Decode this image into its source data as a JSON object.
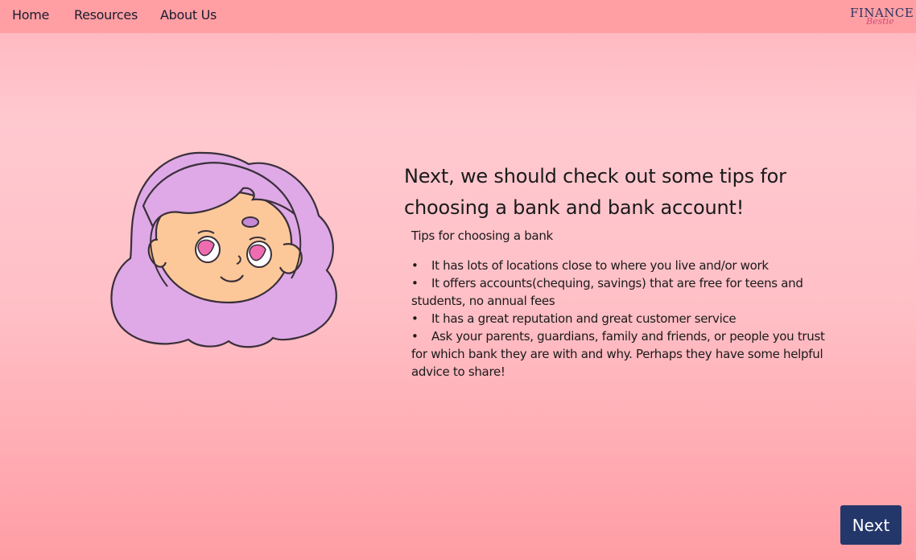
{
  "nav": {
    "items": [
      {
        "label": "Home"
      },
      {
        "label": "Resources"
      },
      {
        "label": "About Us"
      }
    ],
    "logo": {
      "main": "FINANCE",
      "sub": "Bestie"
    }
  },
  "main": {
    "heading": "Next, we should check out some tips for choosing a bank and bank account!",
    "subtitle": "Tips for choosing a bank",
    "bullet_glyph": "•",
    "tips": [
      "It has lots of locations close to where you live and/or work",
      "It offers accounts(chequing, savings) that are free for teens and students, no annual fees",
      "It has a great reputation and great customer service",
      "Ask your parents, guardians, family and friends, or people you trust for which bank they are with and why. Perhaps they have some helpful advice to share!"
    ],
    "illustration": "girl-with-purple-hair"
  },
  "footer": {
    "next_label": "Next"
  },
  "colors": {
    "nav_bg": "#ff9fa3",
    "hair": "#dea9e6",
    "skin": "#fdc899",
    "button_bg": "#24376a"
  }
}
